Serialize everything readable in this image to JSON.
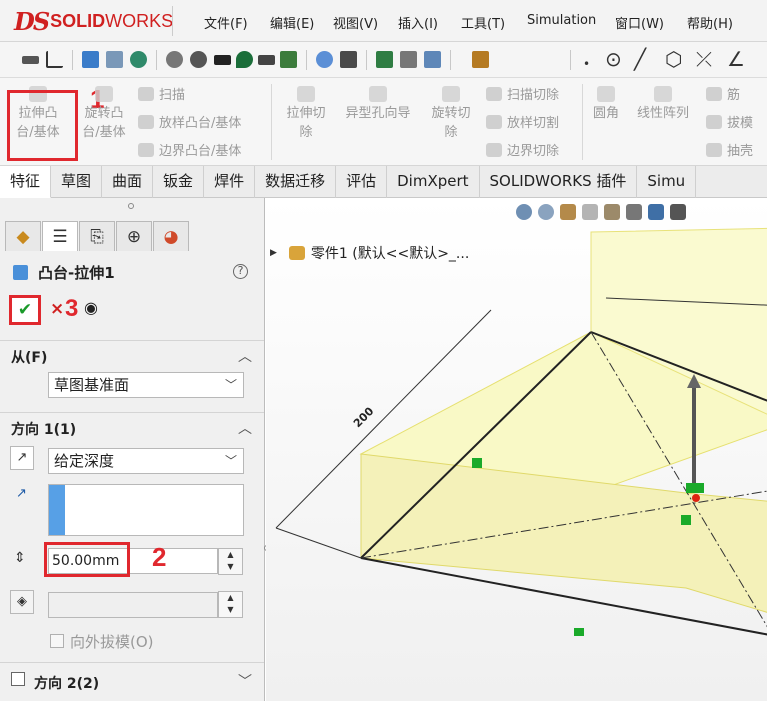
{
  "app": {
    "logo_prefix": "DS",
    "logo_bold": "SOLID",
    "logo_light": "WORKS"
  },
  "menu": {
    "items": [
      "文件(F)",
      "编辑(E)",
      "视图(V)",
      "插入(I)",
      "工具(T)",
      "Simulation",
      "窗口(W)",
      "帮助(H)"
    ]
  },
  "ribbon": {
    "extrude_boss": "拉伸凸\n台/基体",
    "revolve_boss": "旋转凸\n台/基体",
    "sweep": "扫描",
    "loft": "放样凸台/基体",
    "boundary": "边界凸台/基体",
    "extrude_cut": "拉伸切\n除",
    "hole_wizard": "异型孔向导",
    "revolve_cut": "旋转切\n除",
    "sweep_cut": "扫描切除",
    "loft_cut": "放样切割",
    "boundary_cut": "边界切除",
    "fillet": "圆角",
    "linear_pattern": "线性阵列",
    "rib": "筋",
    "draft": "拔模",
    "shell": "抽壳"
  },
  "tabs": [
    "特征",
    "草图",
    "曲面",
    "钣金",
    "焊件",
    "数据迁移",
    "评估",
    "DimXpert",
    "SOLIDWORKS 插件",
    "Simu"
  ],
  "property_manager": {
    "title": "凸台-拉伸1",
    "help": "?",
    "from_label": "从(F)",
    "from_value": "草图基准面",
    "direction1_label": "方向 1(1)",
    "end_condition": "给定深度",
    "depth_value": "50.00mm",
    "draft_outward": "向外拔模(O)",
    "direction2_label": "方向 2(2)"
  },
  "annotations": {
    "step1": "1",
    "step2": "2",
    "step3": "3",
    "color": "#e0282e"
  },
  "viewport": {
    "tree_item": "零件1 (默认<<默认>_...",
    "dimension_label": "200"
  }
}
